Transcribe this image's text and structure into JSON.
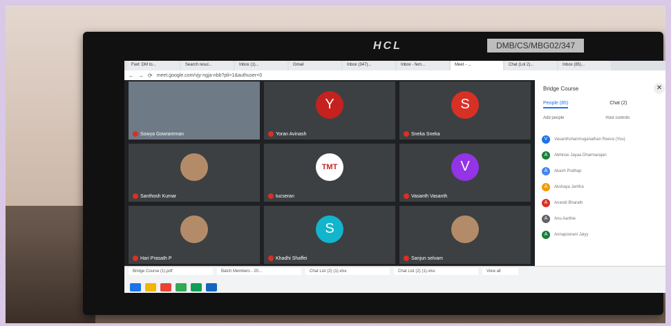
{
  "monitor": {
    "brand": "HCL",
    "asset_tag": "DMB/CS/MBG02/347"
  },
  "browser": {
    "tabs": [
      "Fwd: DM to...",
      "Search resul...",
      "Inbox (1)...",
      "Gmail",
      "Inbox (347)...",
      "Inbox - fern...",
      "Meet - ...",
      "Chat (Lol 2)...",
      "Inbox (85)..."
    ],
    "url": "meet.google.com/vjy-ngja-nbb?pli=1&authuser=0"
  },
  "tiles": [
    {
      "name": "Sowya Gowramman",
      "kind": "presenter"
    },
    {
      "name": "Yoran Avinash",
      "kind": "avatar",
      "letter": "Y",
      "color": "#c5221f"
    },
    {
      "name": "Sneka Sneka",
      "kind": "avatar",
      "letter": "S",
      "color": "#d93025"
    },
    {
      "name": "Santhosh Kumar",
      "kind": "photo"
    },
    {
      "name": "tucseran",
      "kind": "logo",
      "logo_text": "TMT"
    },
    {
      "name": "Vasanth Vasanth",
      "kind": "avatar",
      "letter": "V",
      "color": "#9334e6"
    },
    {
      "name": "Hari Prasath P",
      "kind": "photo"
    },
    {
      "name": "Khadhi Shaffei",
      "kind": "avatar",
      "letter": "S",
      "color": "#12b5cb"
    },
    {
      "name": "Sanjun selvam",
      "kind": "photo"
    }
  ],
  "panel": {
    "title": "Bridge Course",
    "tab_people": "People (85)",
    "tab_chat": "Chat (2)",
    "add_people": "Add people",
    "host_controls": "Host controls",
    "people": [
      {
        "letter": "V",
        "color": "#1a73e8",
        "name": "Vasanthshanmuganathan Reeva (You)"
      },
      {
        "letter": "A",
        "color": "#188038",
        "name": "Abhinav Jayaa Dharmarajan"
      },
      {
        "letter": "A",
        "color": "#4285f4",
        "name": "Akash Prathap"
      },
      {
        "letter": "A",
        "color": "#f29900",
        "name": "Akshaya Jeritha"
      },
      {
        "letter": "A",
        "color": "#d93025",
        "name": "Anandi Bharath"
      },
      {
        "letter": "A",
        "color": "#5f6368",
        "name": "Anu Aarthie"
      },
      {
        "letter": "A",
        "color": "#188038",
        "name": "Annapoorani Jaiyy"
      }
    ],
    "view_all": "View all"
  },
  "downloads": [
    "Bridge Course (1).pdf",
    "Batch Members - 20...",
    "Chat List (2) (1).xlsx",
    "Chat List (2) (1).xlsx"
  ],
  "tray_colors": [
    "#1a73e8",
    "#f4b400",
    "#ea4335",
    "#34a853",
    "#0f9d58",
    "#1565c0"
  ]
}
